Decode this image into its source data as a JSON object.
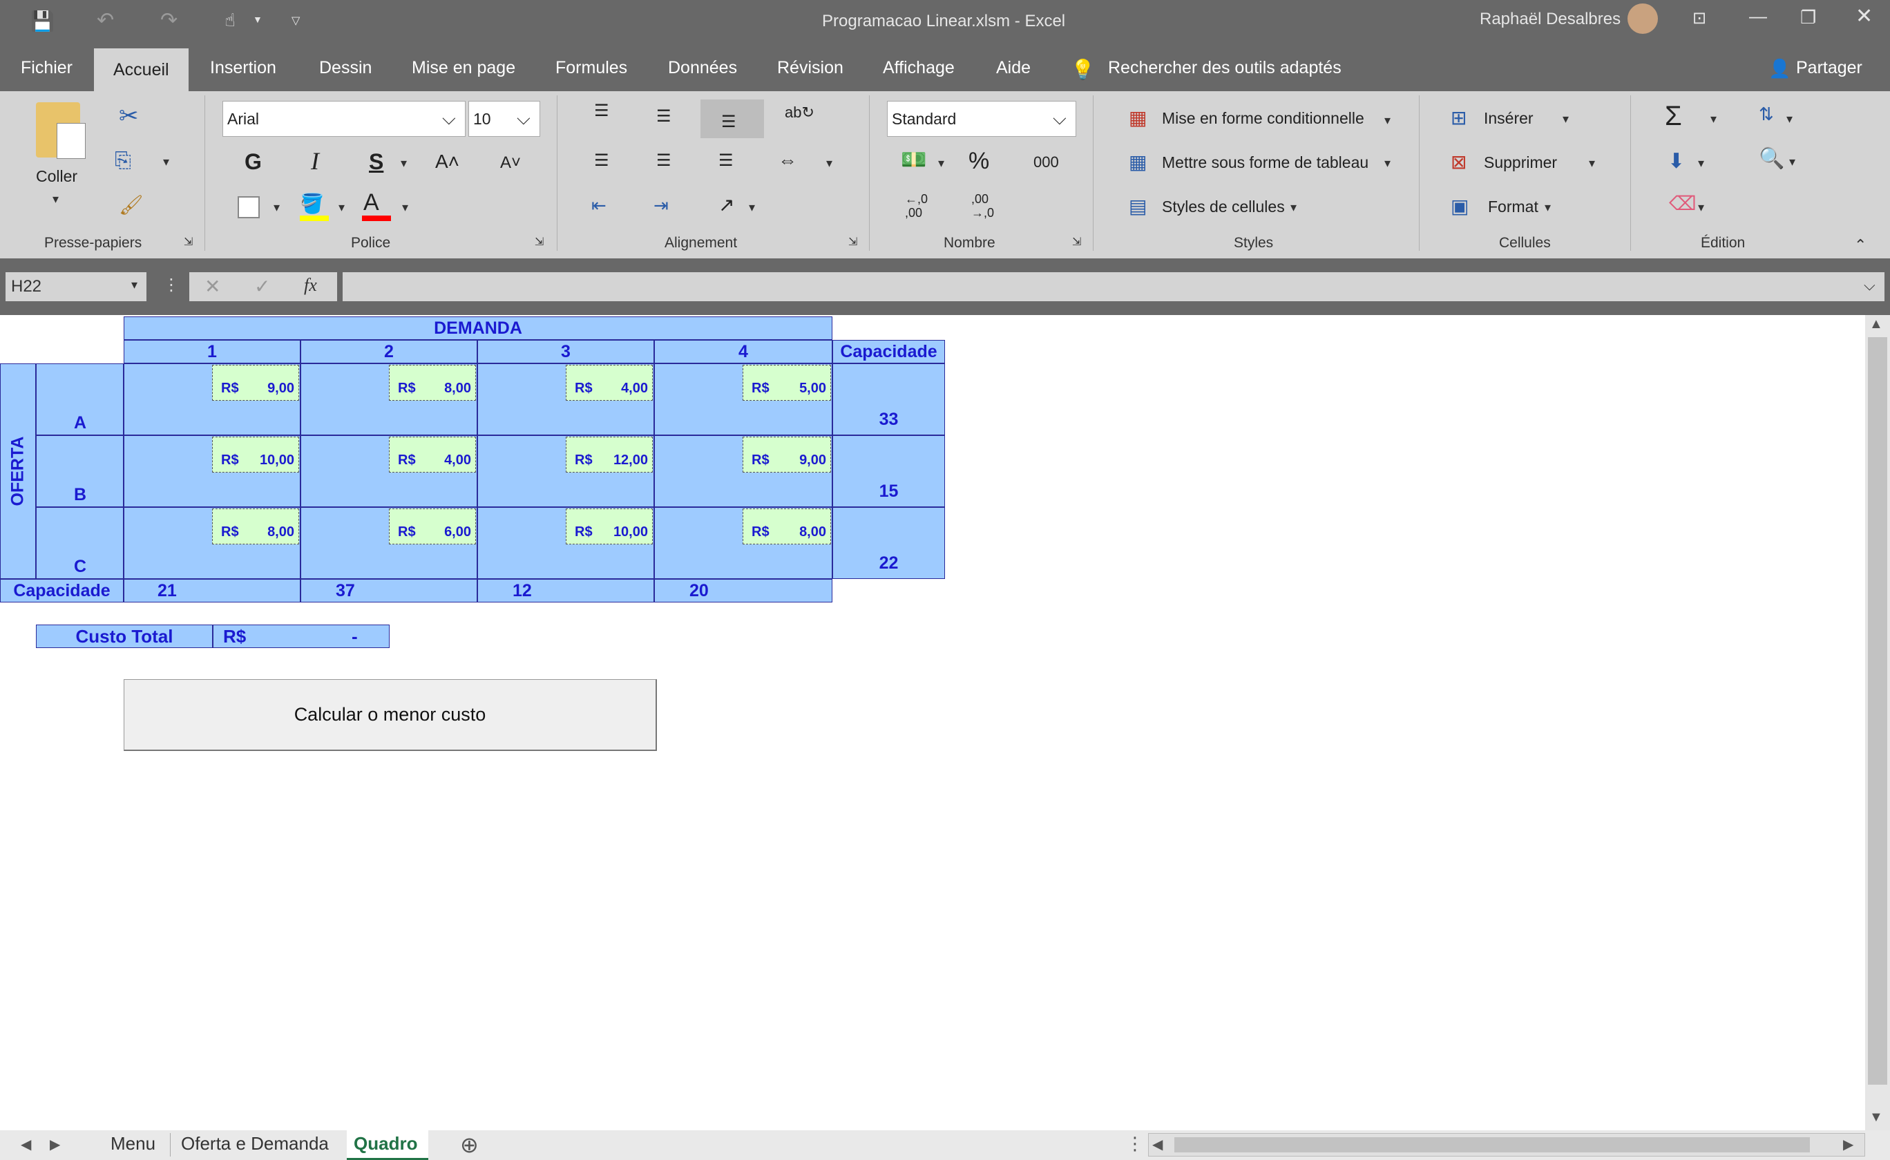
{
  "window": {
    "title": "Programacao Linear.xlsm  -  Excel",
    "user": "Raphaël Desalbres"
  },
  "ribbon_tabs": [
    "Fichier",
    "Accueil",
    "Insertion",
    "Dessin",
    "Mise en page",
    "Formules",
    "Données",
    "Révision",
    "Affichage",
    "Aide"
  ],
  "active_tab": "Accueil",
  "tell_me": "Rechercher des outils adaptés",
  "share_label": "Partager",
  "clipboard": {
    "paste_label": "Coller",
    "group_label": "Presse-papiers"
  },
  "font": {
    "name": "Arial",
    "size": "10",
    "bold": "G",
    "italic": "I",
    "underline": "S",
    "group_label": "Police"
  },
  "alignment": {
    "group_label": "Alignement"
  },
  "number": {
    "format": "Standard",
    "percent": "%",
    "thousands": "000",
    "inc_decimal": "←,0\n,00",
    "dec_decimal": ",00\n→,0",
    "group_label": "Nombre"
  },
  "styles": {
    "cond_format": "Mise en forme conditionnelle",
    "format_table": "Mettre sous forme de tableau",
    "cell_styles": "Styles de cellules",
    "group_label": "Styles"
  },
  "cells": {
    "insert": "Insérer",
    "delete": "Supprimer",
    "format": "Format",
    "group_label": "Cellules"
  },
  "editing": {
    "group_label": "Édition"
  },
  "formula_bar": {
    "name_box": "H22",
    "fx": "fx",
    "content": ""
  },
  "sheet": {
    "demanda_header": "DEMANDA",
    "oferta_label": "OFERTA",
    "capacidade_label": "Capacidade",
    "columns": [
      "1",
      "2",
      "3",
      "4"
    ],
    "currency": "R$",
    "rows": [
      {
        "label": "A",
        "costs": [
          "9,00",
          "8,00",
          "4,00",
          "5,00"
        ],
        "capacity": "33"
      },
      {
        "label": "B",
        "costs": [
          "10,00",
          "4,00",
          "12,00",
          "9,00"
        ],
        "capacity": "15"
      },
      {
        "label": "C",
        "costs": [
          "8,00",
          "6,00",
          "10,00",
          "8,00"
        ],
        "capacity": "22"
      }
    ],
    "demand_capacity": [
      "21",
      "37",
      "12",
      "20"
    ],
    "custo_total_label": "Custo Total",
    "custo_total_currency": "R$",
    "custo_total_value": "-",
    "button_label": "Calcular o menor custo"
  },
  "sheet_tabs": [
    "Menu",
    "Oferta e Demanda",
    "Quadro"
  ],
  "active_sheet": "Quadro"
}
